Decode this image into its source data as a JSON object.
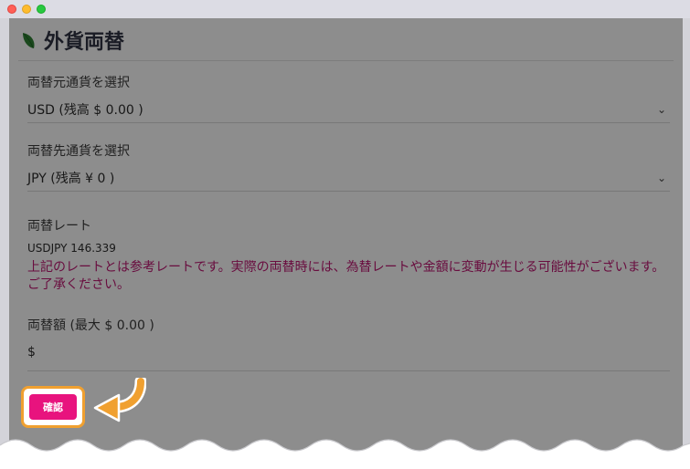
{
  "page": {
    "title": "外貨両替"
  },
  "from_currency": {
    "label": "両替元通貨を選択",
    "selected": "USD (残高 $ 0.00 )"
  },
  "to_currency": {
    "label": "両替先通貨を選択",
    "selected": "JPY (残高 ¥ 0 )"
  },
  "rate": {
    "label": "両替レート",
    "pair": "USDJPY 146.339",
    "note": "上記のレートとは参考レートです。実際の両替時には、為替レートや金額に変動が生じる可能性がございます。ご了承ください。"
  },
  "amount": {
    "label": "両替額 (最大 $ 0.00 )",
    "prefix": "$",
    "value": ""
  },
  "confirm": {
    "label": "確認"
  },
  "colors": {
    "accent": "#e8137e",
    "note_text": "#b5176d",
    "highlight": "#f0a030",
    "leaf": "#2e7d32"
  },
  "icons": {
    "header": "leaf-icon",
    "select": "chevron-down-icon",
    "pointer": "arrow-left-icon"
  }
}
